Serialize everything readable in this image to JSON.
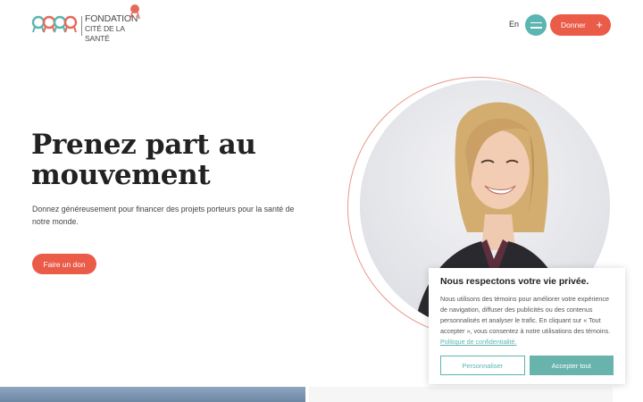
{
  "header": {
    "logo_line1": "FONDATION",
    "logo_line2": "CITÉ DE LA SANTÉ",
    "language_label": "En",
    "donate_label": "Donner",
    "donate_icon": "plus-icon",
    "menu_icon": "hamburger-icon"
  },
  "hero": {
    "title": "Prenez part au mouvement",
    "text": "Donnez généreusement pour financer des projets porteurs pour la santé de notre monde.",
    "cta_label": "Faire un don"
  },
  "cookie": {
    "title": "Nous respectons votre vie privée.",
    "body": "Nous utilisons des témoins pour améliorer votre expérience de navigation, diffuser des publicités ou des contenus personnalisés et analyser le trafic. En cliquant sur « Tout accepter », vous consentez à notre utilisations des témoins.",
    "policy_link": "Politique de confidentialité.",
    "customize_label": "Personnaliser",
    "accept_label": "Accepter tout"
  },
  "colors": {
    "accent_coral": "#ea5b48",
    "accent_teal": "#5bb5b0"
  }
}
